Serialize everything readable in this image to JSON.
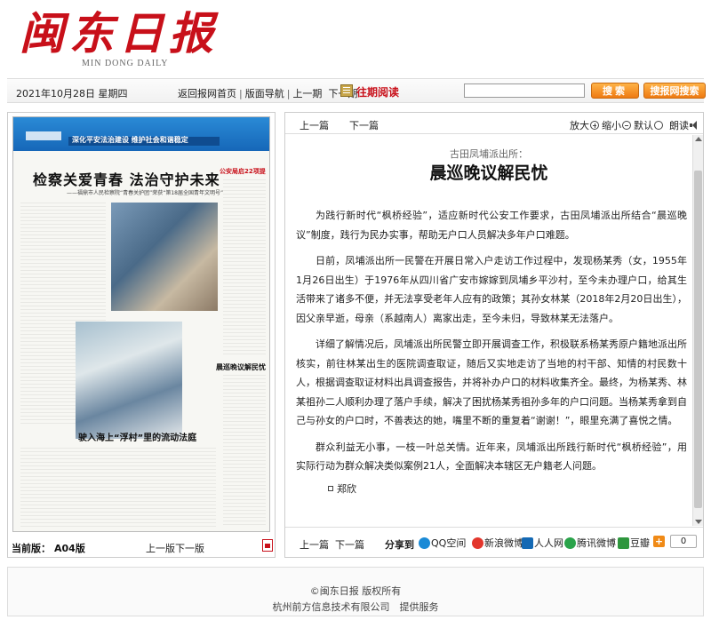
{
  "header": {
    "logo_cn": "闽东日报",
    "logo_en": "MIN DONG DAILY"
  },
  "navbar": {
    "date": "2021年10月28日 星期四",
    "home_link": "返回报网首页",
    "sep": "|",
    "section_nav": "版面导航",
    "prev_issue": "上一期",
    "next_issue": "下一期",
    "past_reading": "往期阅读",
    "search_placeholder": "",
    "search_button": "搜索",
    "net_search_button": "搜报网搜索"
  },
  "paper_preview": {
    "section_slogan": "深化平安法治建设 维护社会和谐稳定",
    "headline_main": "检察关爱青春 法治守护未来",
    "headline_sub": "——福鼎市人民检察院“青春关护团”荣获“第18届全国青年文明号”",
    "headline_second": "驶入海上“浮村”里的流动法庭",
    "headline_side": "晨巡晚议解民忧",
    "headline_top_right": "公安局启22项提"
  },
  "left_panel": {
    "edition_label": "当前版：",
    "edition_value": "A04版",
    "prev_page": "上一版",
    "next_page": "下一版"
  },
  "article_toolbar": {
    "prev": "上一篇",
    "next": "下一篇",
    "zoom_in": "放大",
    "zoom_out": "缩小",
    "zoom_default": "默认",
    "read_aloud": "朗读"
  },
  "article": {
    "pre_title": "古田凤埔派出所：",
    "title": "晨巡晚议解民忧",
    "paragraphs": [
      "为践行新时代“枫桥经验”，适应新时代公安工作要求，古田凤埔派出所结合“晨巡晚议”制度，践行为民办实事，帮助无户口人员解决多年户口难题。",
      "日前，凤埔派出所一民警在开展日常入户走访工作过程中，发现杨某秀（女，1955年1月26日出生）于1976年从四川省广安市嫁嫁到凤埔乡平沙村，至今未办理户口，给其生活带来了诸多不便，并无法享受老年人应有的政策；其孙女林某（2018年2月20日出生），因父亲早逝，母亲（系越南人）离家出走，至今未归，导致林某无法落户。",
      "详细了解情况后，凤埔派出所民警立即开展调查工作，积极联系杨某秀原户籍地派出所核实，前往林某出生的医院调查取证，随后又实地走访了当地的村干部、知情的村民数十人，根据调查取证材料出具调查报告，并将补办户口的材料收集齐全。最终，为杨某秀、林某祖孙二人顺利办理了落户手续，解决了困扰杨某秀祖孙多年的户口问题。当杨某秀拿到自己与孙女的户口时，不善表达的她，嘴里不断的重复着“谢谢！”，眼里充满了喜悦之情。",
      "群众利益无小事，一枝一叶总关情。近年来，凤埔派出所践行新时代“枫桥经验”，用实际行动为群众解决类似案例21人，全面解决本辖区无户籍老人问题。"
    ],
    "author": "郑欣"
  },
  "share_bar": {
    "prev": "上一篇",
    "next": "下一篇",
    "label": "分享到",
    "qq": "QQ空间",
    "weibo": "新浪微博",
    "renren": "人人网",
    "tweibo": "腾讯微博",
    "douban": "豆瓣",
    "more": "+",
    "count": "0"
  },
  "footer": {
    "copyright": "©闽东日报 版权所有",
    "provider": "杭州前方信息技术有限公司　提供服务"
  },
  "colors": {
    "brand_red": "#c8101a",
    "accent_orange": "#ee7a12",
    "paper_blue": "#1667b8"
  }
}
